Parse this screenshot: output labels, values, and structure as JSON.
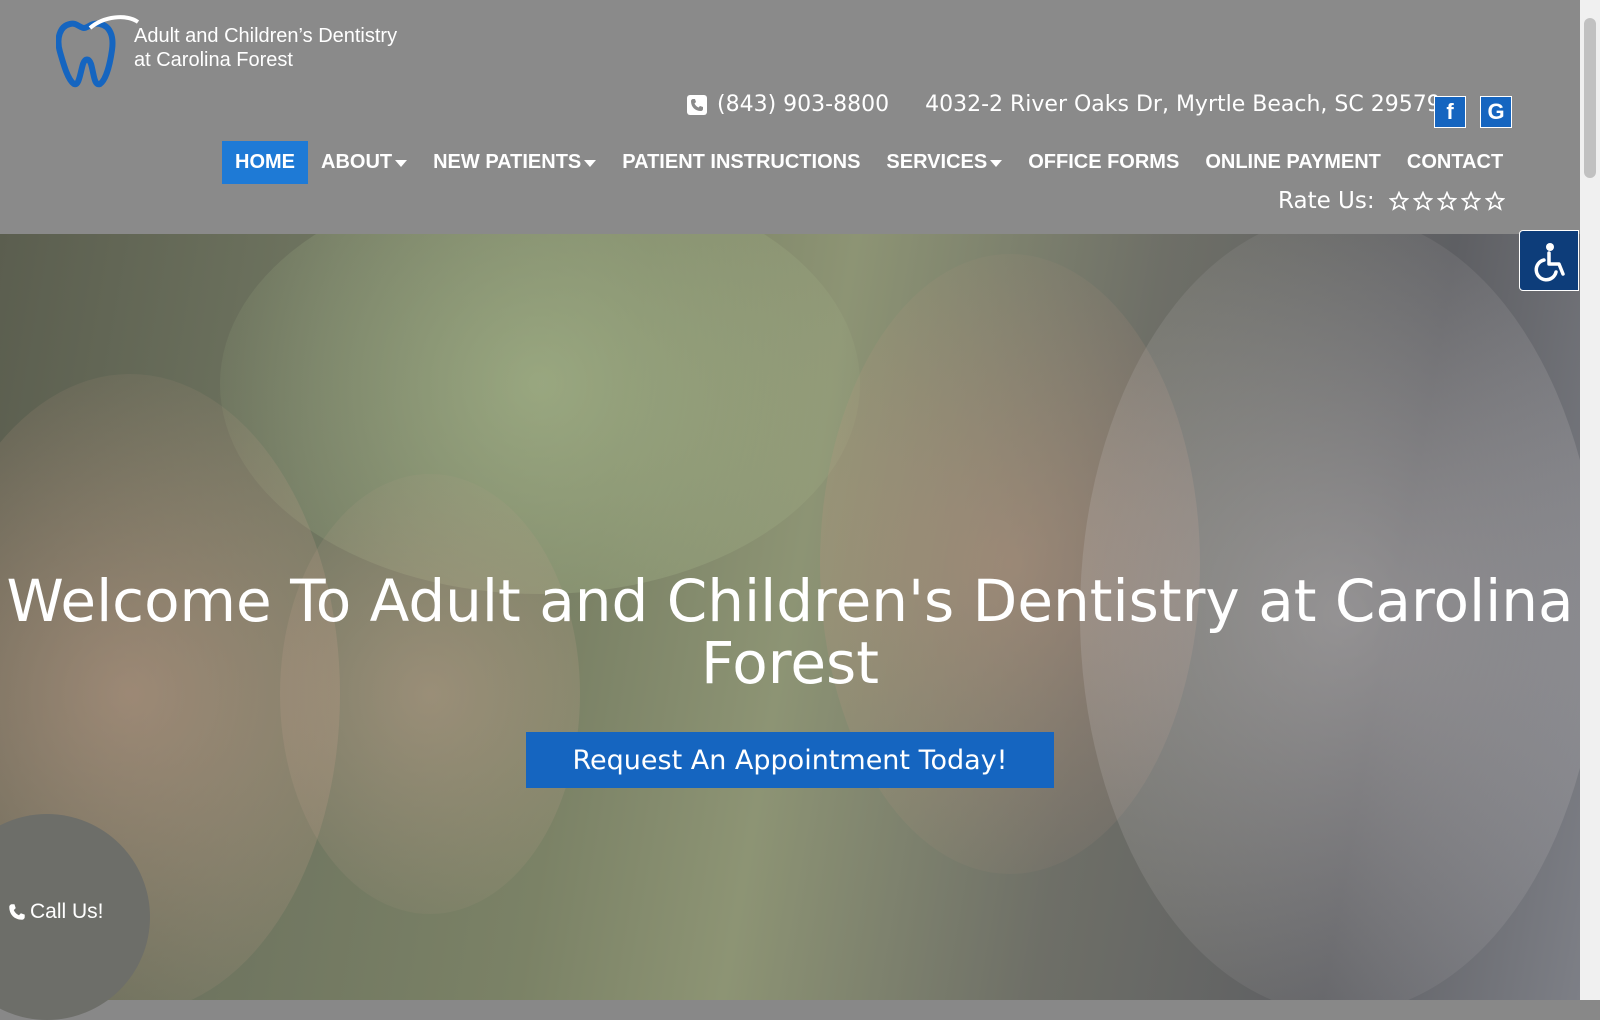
{
  "brand": {
    "name_line1": "Adult and Children’s Dentistry",
    "name_line2": "at Carolina Forest",
    "accent": "#1e7ad6",
    "cta_color": "#1565c0"
  },
  "contact": {
    "phone": "(843) 903-8800",
    "address": "4032-2 River Oaks Dr, Myrtle Beach, SC 29579"
  },
  "social": {
    "facebook": "f",
    "google": "G"
  },
  "nav": {
    "home": "HOME",
    "about": "ABOUT",
    "new_patients": "NEW PATIENTS",
    "patient_instructions": "PATIENT INSTRUCTIONS",
    "services": "SERVICES",
    "office_forms": "OFFICE FORMS",
    "online_payment": "ONLINE PAYMENT",
    "contact": "CONTACT"
  },
  "rating": {
    "label": "Rate Us:",
    "stars_filled": 0,
    "stars_total": 5
  },
  "hero": {
    "title": "Welcome To Adult and Children's Dentistry at Carolina Forest",
    "cta": "Request An Appointment Today!"
  },
  "call_widget": {
    "label": "Call Us!"
  }
}
